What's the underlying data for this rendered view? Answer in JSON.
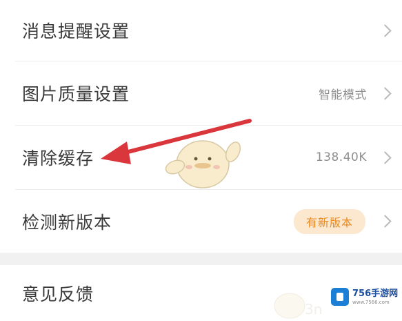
{
  "settings": {
    "items": [
      {
        "label": "消息提醒设置",
        "value": ""
      },
      {
        "label": "图片质量设置",
        "value": "智能模式"
      },
      {
        "label": "清除缓存",
        "value": "138.40K"
      },
      {
        "label": "检测新版本",
        "badge": "有新版本"
      },
      {
        "label": "意见反馈",
        "value": ""
      }
    ]
  },
  "watermark": {
    "title": "756手游网",
    "url": "www.7566.com"
  },
  "colors": {
    "arrow": "#d9373c",
    "badge_bg": "#fbe8cf",
    "badge_text": "#e88b25",
    "chevron": "#b9b9b9"
  },
  "icons": [
    "chevron-right-icon",
    "red-arrow-annotation",
    "mascot-sticker",
    "756-logo-icon"
  ]
}
